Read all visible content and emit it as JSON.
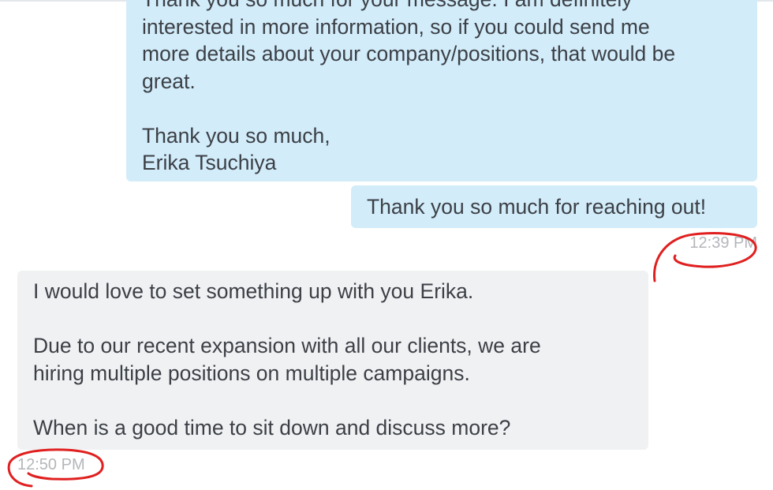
{
  "conversation": {
    "messages": [
      {
        "direction": "outgoing",
        "lines": [
          "Thank you so much for your message. I am definitely",
          "interested in more information, so if you could send me",
          "more details about your company/positions, that would be",
          "great.",
          "",
          "Thank you so much,",
          "Erika Tsuchiya"
        ]
      },
      {
        "direction": "outgoing",
        "text": "Thank you so much for reaching out!",
        "timestamp": "12:39 PM"
      },
      {
        "direction": "incoming",
        "lines": [
          "I would love to set something up with you Erika.",
          "",
          "Due to our recent expansion with all our clients, we are",
          "hiring multiple positions on multiple campaigns.",
          "",
          "When is a good time to sit down and discuss more?"
        ],
        "timestamp": "12:50 PM"
      }
    ]
  },
  "colors": {
    "outgoing_bubble": "#d2ecfa",
    "incoming_bubble": "#f0f1f3",
    "timestamp_text": "#b3b6ba",
    "annotation_circle": "#e02020"
  }
}
